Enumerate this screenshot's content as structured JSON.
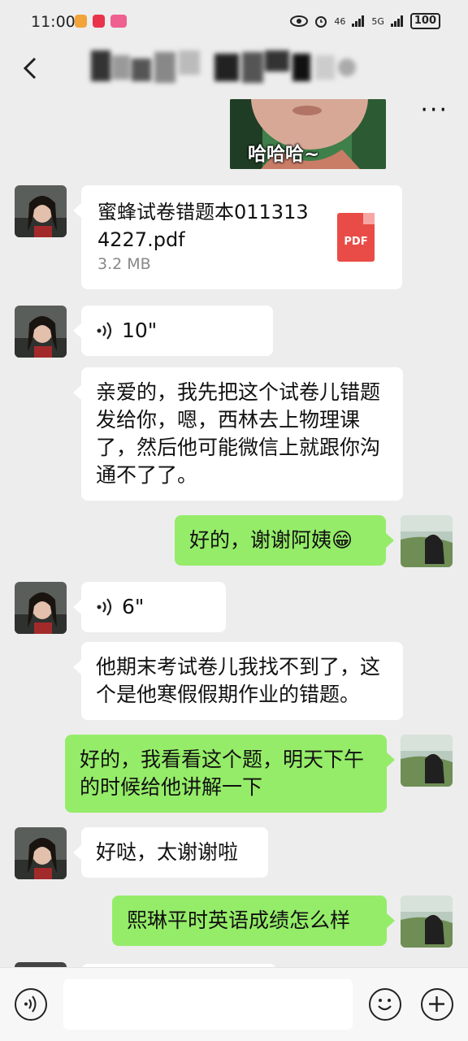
{
  "status_bar": {
    "time": "11:00",
    "signal_1": "46",
    "signal_2": "5G",
    "battery": "100"
  },
  "header": {
    "title": "",
    "back_icon": "chevron-left-icon",
    "more_label": "···"
  },
  "messages": [
    {
      "sender": "me",
      "type": "image",
      "caption": "哈哈哈~"
    },
    {
      "sender": "them",
      "type": "file",
      "file_name": "蜜蜂试卷错题本0113134227.pdf",
      "file_size": "3.2 MB",
      "file_icon_label": "PDF"
    },
    {
      "sender": "them",
      "type": "voice",
      "duration": "10\""
    },
    {
      "sender": "them",
      "type": "text",
      "text": "亲爱的，我先把这个试卷儿错题发给你，嗯，西林去上物理课了，然后他可能微信上就跟你沟通不了了。"
    },
    {
      "sender": "me",
      "type": "text",
      "text": "好的，谢谢阿姨😁"
    },
    {
      "sender": "them",
      "type": "voice",
      "duration": "6\""
    },
    {
      "sender": "them",
      "type": "text",
      "text": "他期末考试卷儿我找不到了，这个是他寒假假期作业的错题。"
    },
    {
      "sender": "me",
      "type": "text",
      "text": "好的，我看看这个题，明天下午的时候给他讲解一下"
    },
    {
      "sender": "them",
      "type": "text",
      "text": "好哒，太谢谢啦"
    },
    {
      "sender": "me",
      "type": "text",
      "text": "熙琳平时英语成绩怎么样"
    }
  ],
  "input_bar": {
    "voice_icon": "voice-mode-icon",
    "input_value": "",
    "emoji_icon": "emoji-icon",
    "plus_icon": "plus-icon"
  },
  "colors": {
    "background": "#ededed",
    "my_bubble": "#95ec69",
    "their_bubble": "#ffffff",
    "pdf_icon": "#e94c46"
  }
}
